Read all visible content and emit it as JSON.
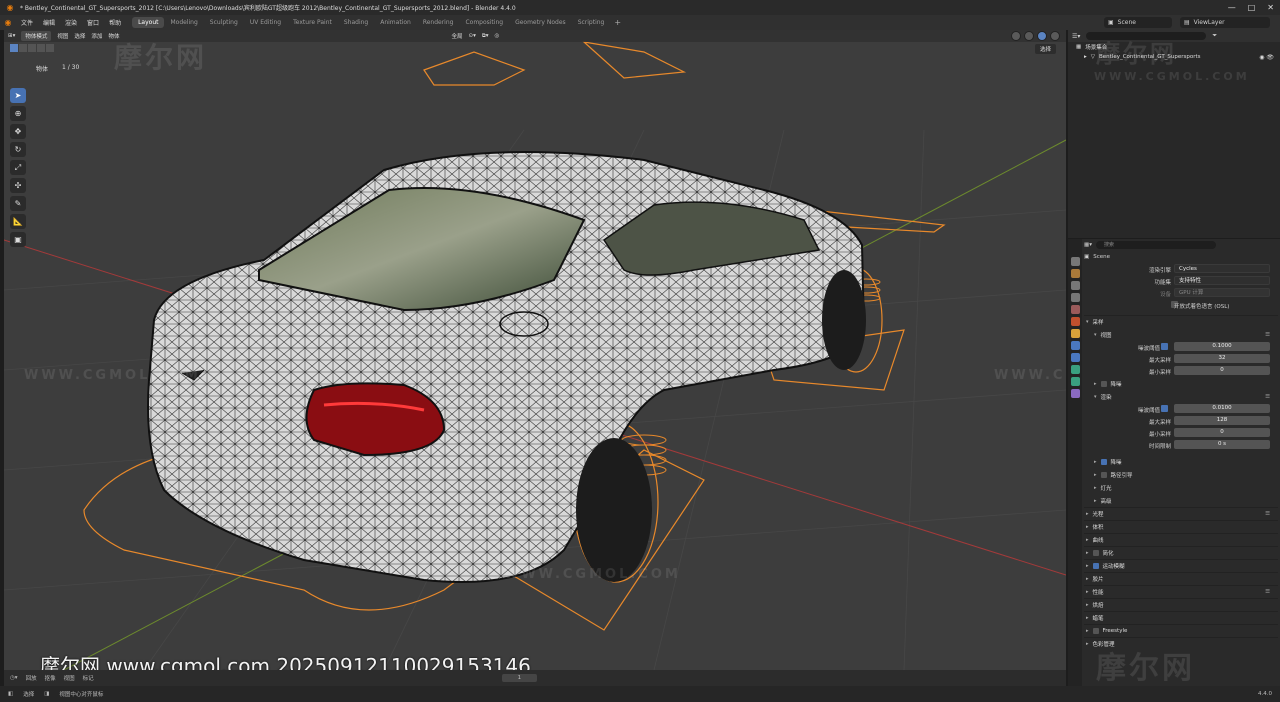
{
  "window": {
    "title": "* Bentley_Continental_GT_Supersports_2012 [C:\\Users\\Lenovo\\Downloads\\宾利欧陆GT超级跑车 2012\\Bentley_Continental_GT_Supersports_2012.blend] - Blender 4.4.0",
    "controls": [
      "—",
      "□",
      "✕"
    ]
  },
  "menubar": {
    "menus": [
      "文件",
      "编辑",
      "渲染",
      "窗口",
      "帮助"
    ],
    "workspaces": [
      "Layout",
      "Modeling",
      "Sculpting",
      "UV Editing",
      "Texture Paint",
      "Shading",
      "Animation",
      "Rendering",
      "Compositing",
      "Geometry Nodes",
      "Scripting"
    ],
    "active_workspace": "Layout",
    "scene": "Scene",
    "view_layer": "ViewLayer"
  },
  "viewport": {
    "mode": "物体模式",
    "menus": [
      "视图",
      "选择",
      "添加",
      "物体"
    ],
    "transform_orientation": "全局",
    "select_label": "选择",
    "info_label": "物体",
    "info_count": "1 / 30",
    "tools": [
      "select-icon",
      "cursor-icon",
      "move-icon",
      "rotate-icon",
      "scale-icon",
      "transform-icon",
      "annotate-icon",
      "measure-icon",
      "add-cube-icon"
    ]
  },
  "watermarks": {
    "logo": "摩尔网",
    "url": "WWW.CGMOL.COM"
  },
  "stamp": "摩尔网 www.cgmol.com 20250912110029153146",
  "timeline": {
    "items": [
      "回放",
      "抠像",
      "视图",
      "标记"
    ],
    "frame": "1"
  },
  "statusbar": {
    "left": "选择",
    "middle": "视图中心对齐鼠标",
    "version": "4.4.0"
  },
  "outliner": {
    "collection": "场景集合",
    "object": "Bentley_Continental_GT_Supersports"
  },
  "properties": {
    "search_placeholder": "搜索",
    "scene_name": "Scene",
    "render_engine_label": "渲染引擎",
    "render_engine": "Cycles",
    "feature_set_label": "功能集",
    "feature_set": "支持特性",
    "device_label": "设备",
    "device": "GPU 计算",
    "osl_label": "开放式着色语言 (OSL)",
    "sampling": "采样",
    "viewport_sub": "视图",
    "noise_threshold_label": "噪波阈值",
    "vp_noise_threshold": "0.1000",
    "max_samples_label": "最大采样",
    "vp_max_samples": "32",
    "min_samples_label": "最小采样",
    "vp_min_samples": "0",
    "denoise": "降噪",
    "render_sub": "渲染",
    "r_noise_threshold": "0.0100",
    "r_max_samples": "128",
    "r_min_samples": "0",
    "time_limit_label": "时间限制",
    "r_time_limit": "0 s",
    "render_children": [
      "降噪",
      "路径引导",
      "灯光",
      "高级"
    ],
    "panels": [
      "光程",
      "体积",
      "曲线",
      "简化",
      "运动模糊",
      "胶片",
      "性能",
      "烘焙",
      "蜡笔",
      "Freestyle",
      "色彩管理"
    ]
  },
  "colors": {
    "accent": "#4772b3",
    "orange_outline": "#e8892b",
    "viewport_bg": "#3d3d3d",
    "red_axis": "#a33a3a",
    "green_axis": "#6c8a2d"
  }
}
